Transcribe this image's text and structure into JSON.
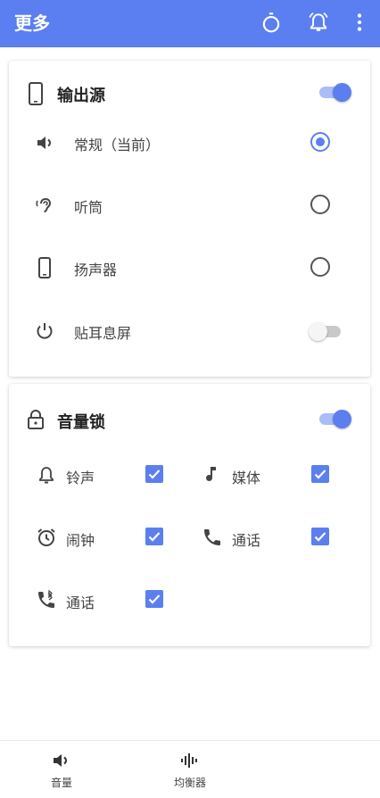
{
  "appbar": {
    "title": "更多",
    "icons": [
      "timer-icon",
      "alarm-bell-icon",
      "more-vert-icon"
    ],
    "color": "#5b7ff0"
  },
  "output_source": {
    "title": "输出源",
    "enabled": true,
    "options": [
      {
        "label": "常规（当前）",
        "icon": "speaker-icon",
        "control": "radio",
        "checked": true
      },
      {
        "label": "听筒",
        "icon": "ear-icon",
        "control": "radio",
        "checked": false
      },
      {
        "label": "扬声器",
        "icon": "phone-icon",
        "control": "radio",
        "checked": false
      },
      {
        "label": "贴耳息屏",
        "icon": "power-icon",
        "control": "toggle",
        "checked": false
      }
    ]
  },
  "volume_lock": {
    "title": "音量锁",
    "enabled": true,
    "items": [
      {
        "label": "铃声",
        "icon": "bell-icon",
        "checked": true
      },
      {
        "label": "媒体",
        "icon": "music-note-icon",
        "checked": true
      },
      {
        "label": "闹钟",
        "icon": "alarm-clock-icon",
        "checked": true
      },
      {
        "label": "通话",
        "icon": "call-icon",
        "checked": true
      },
      {
        "label": "通话",
        "icon": "bluetooth-call-icon",
        "checked": true
      }
    ]
  },
  "bottom_nav": {
    "items": [
      {
        "label": "音量",
        "icon": "volume-icon"
      },
      {
        "label": "均衡器",
        "icon": "equalizer-icon"
      }
    ]
  }
}
